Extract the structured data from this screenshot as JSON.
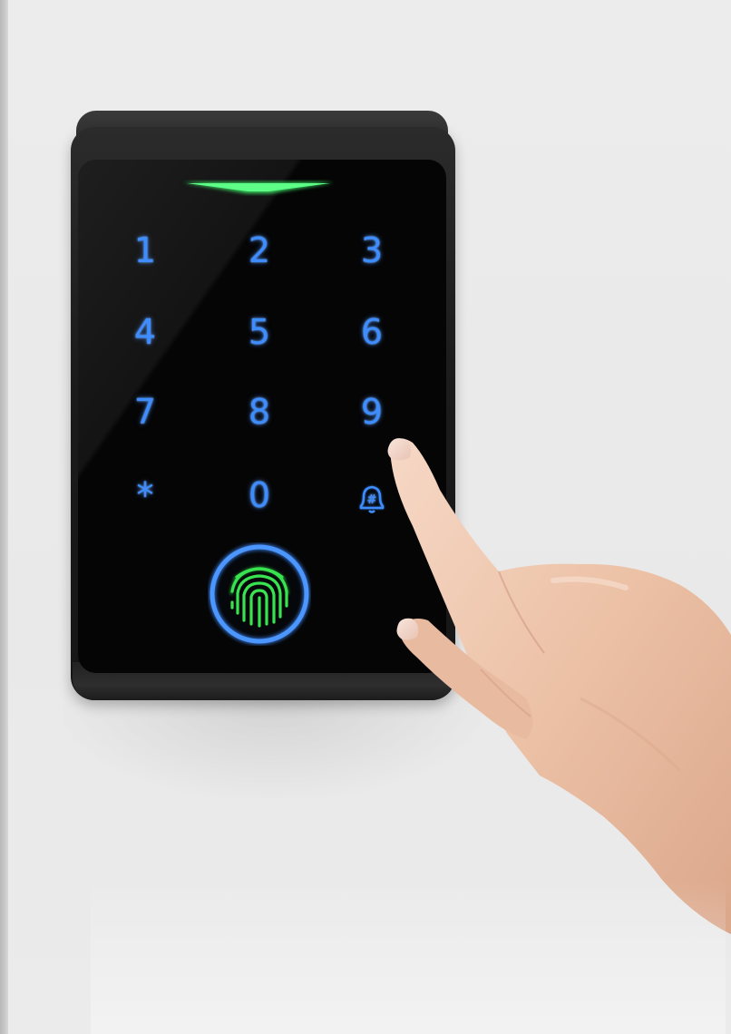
{
  "keypad": {
    "keys": [
      "1",
      "2",
      "3",
      "4",
      "5",
      "6",
      "7",
      "8",
      "9",
      "*",
      "0",
      "bell-hash"
    ],
    "bell_symbol": "#"
  },
  "colors": {
    "key_glow": "#3d8dff",
    "led": "#3df26a",
    "fingerprint": "#39e34f",
    "ring": "#3f8cff",
    "device_body": "#1b1b1b",
    "wall": "#ececec"
  },
  "icons": [
    "fingerprint-icon",
    "bell-icon",
    "status-led"
  ]
}
